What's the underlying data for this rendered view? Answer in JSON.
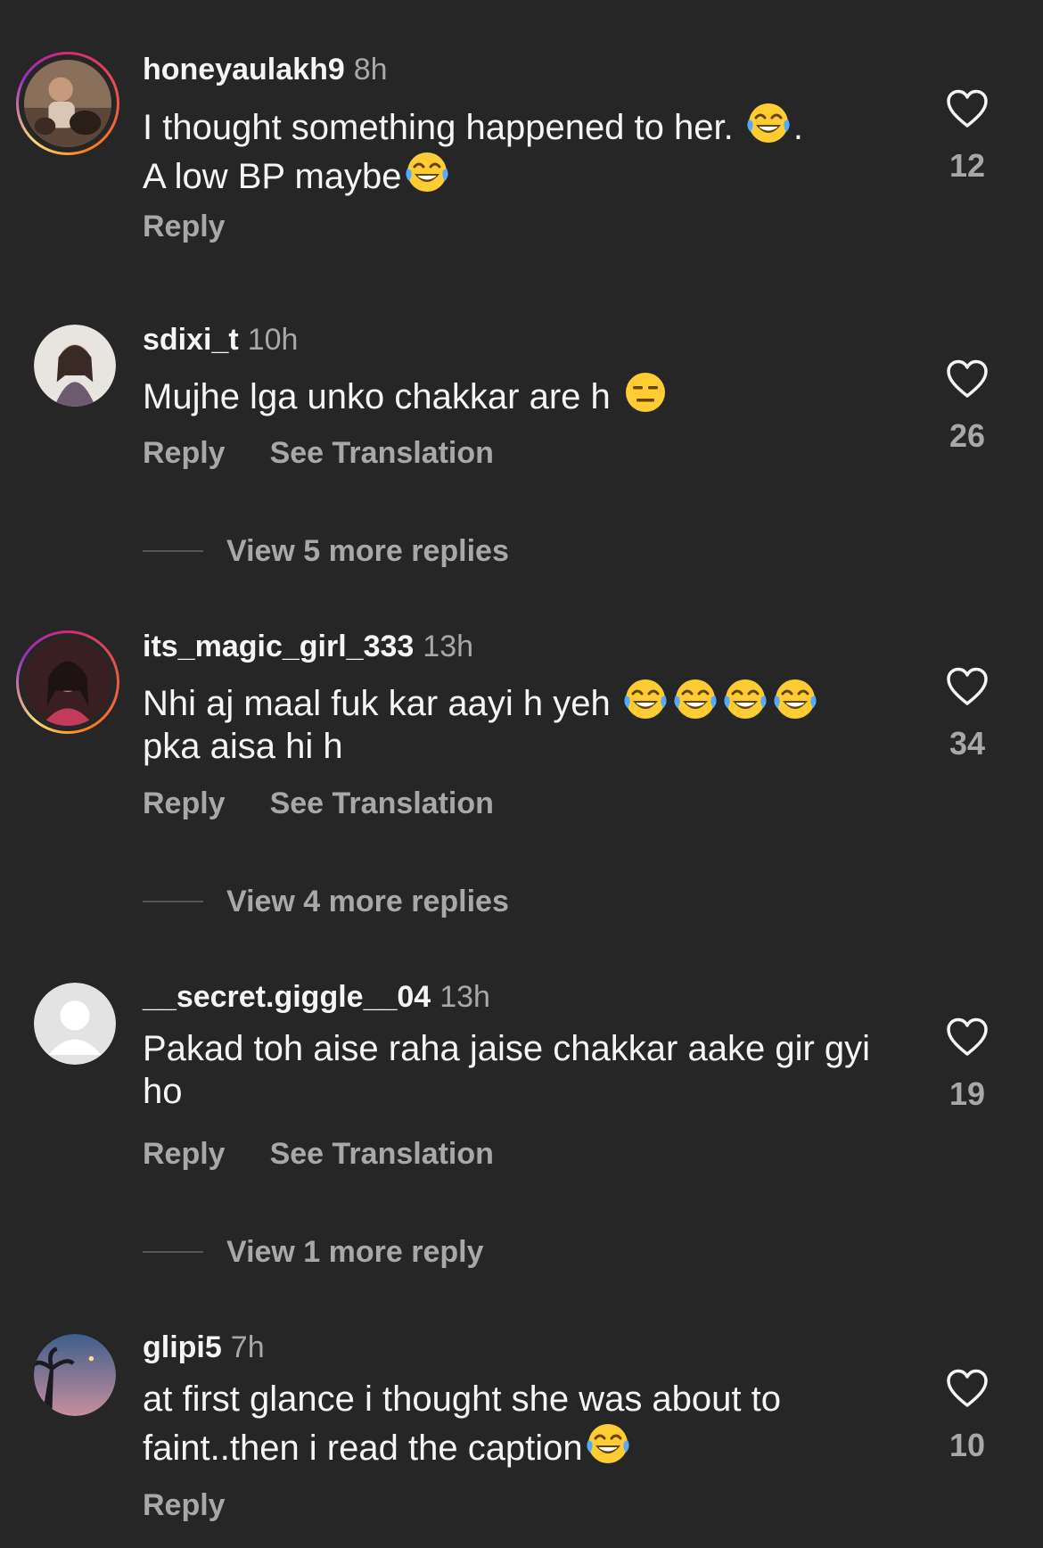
{
  "ui": {
    "reply_label": "Reply",
    "translate_label": "See Translation"
  },
  "comments": [
    {
      "username": "honeyaulakh9",
      "time": "8h",
      "text_parts": [
        "I thought something happened to her. ",
        ".",
        " A low BP maybe",
        ""
      ],
      "emoji": "face-with-tears-of-joy-icon",
      "likes": "12",
      "view_more": ""
    },
    {
      "username": "sdixi_t",
      "time": "10h",
      "text": "Mujhe lga unko chakkar are h ",
      "emoji": "expressionless-face-icon",
      "likes": "26",
      "view_more": "View 5 more replies"
    },
    {
      "username": "its_magic_girl_333",
      "time": "13h",
      "text_a": "Nhi aj maal fuk kar aayi h yeh ",
      "text_b": "pka aisa hi h",
      "emoji": "face-with-tears-of-joy-icon",
      "likes": "34",
      "view_more": "View 4 more replies"
    },
    {
      "username": "__secret.giggle__04",
      "time": "13h",
      "text": "Pakad toh aise raha jaise chakkar aake gir gyi ho",
      "likes": "19",
      "view_more": "View 1 more reply"
    },
    {
      "username": "glipi5",
      "time": "7h",
      "text": "at first glance i thought she was about to faint..then i read the caption",
      "emoji": "face-with-tears-of-joy-icon",
      "likes": "10",
      "view_more": ""
    }
  ],
  "colors": {
    "background": "#262626",
    "text_primary": "#f5f5f5",
    "text_secondary": "#a8a8a8",
    "story_ring": "#d62976"
  }
}
